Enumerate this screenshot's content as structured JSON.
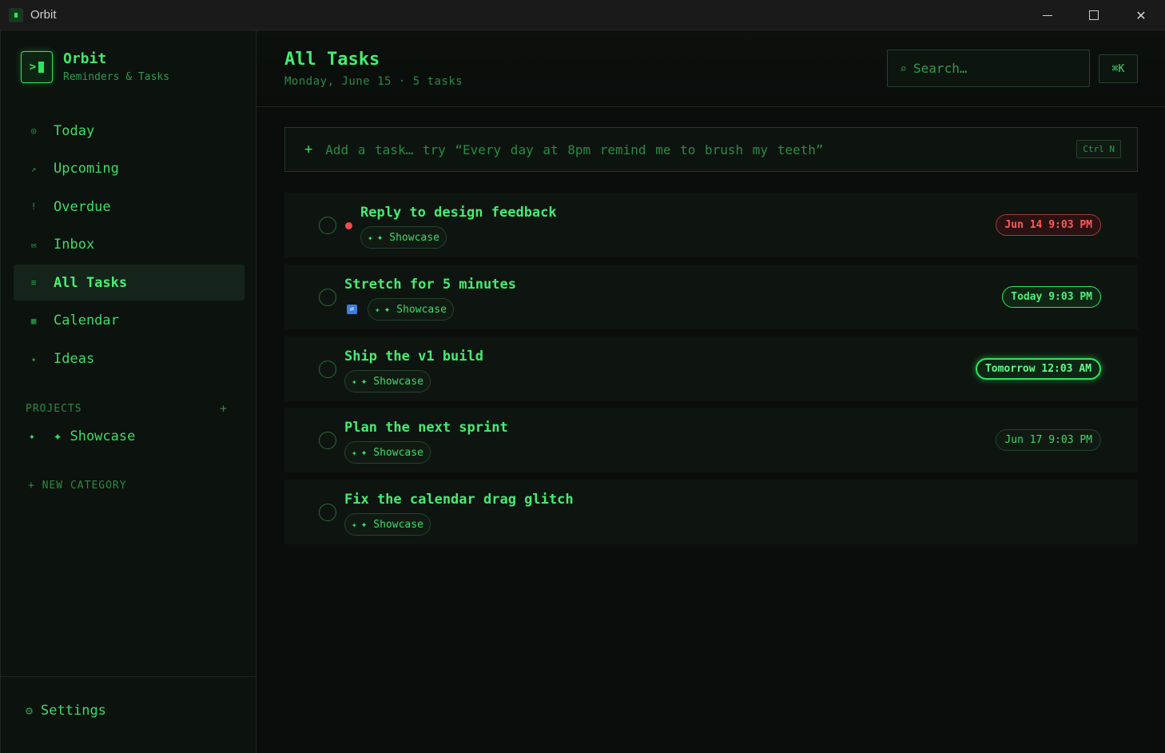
{
  "window": {
    "title": "Orbit"
  },
  "brand": {
    "name": "Orbit",
    "subtitle": "Reminders & Tasks",
    "logo_text": ">"
  },
  "nav": [
    {
      "icon": "◎",
      "label": "Today"
    },
    {
      "icon": "↗",
      "label": "Upcoming"
    },
    {
      "icon": "!",
      "label": "Overdue"
    },
    {
      "icon": "✉",
      "label": "Inbox"
    },
    {
      "icon": "≡",
      "label": "All Tasks"
    },
    {
      "icon": "▦",
      "label": "Calendar"
    },
    {
      "icon": "✦",
      "label": "Ideas"
    }
  ],
  "projects": {
    "heading": "PROJECTS",
    "add": "+",
    "items": [
      {
        "icon": "✦",
        "label": "✦ Showcase"
      }
    ]
  },
  "new_category": "+ NEW CATEGORY",
  "settings": {
    "icon": "⚙",
    "label": "Settings"
  },
  "header": {
    "title": "All Tasks",
    "subtitle": "Monday, June 15 · 5 tasks"
  },
  "search": {
    "icon": "⌕",
    "placeholder": "Search…",
    "shortcut": "⌘K"
  },
  "add_task": {
    "plus": "+",
    "placeholder": "Add a task…  try “Every day at 8pm remind me to brush my teeth”",
    "shortcut": "Ctrl N"
  },
  "tasks": [
    {
      "title": "Reply to design feedback",
      "project": "✦ Showcase",
      "project_icon": "✦",
      "due": "Jun 14 9:03 PM",
      "priority": "high"
    },
    {
      "title": "Stretch for 5 minutes",
      "project": "✦ Showcase",
      "project_icon": "✦",
      "due": "Today 9:03 PM",
      "repeat_icon": "⇄"
    },
    {
      "title": "Ship the v1 build",
      "project": "✦ Showcase",
      "project_icon": "✦",
      "due": "Tomorrow 12:03 AM"
    },
    {
      "title": "Plan the next sprint",
      "project": "✦ Showcase",
      "project_icon": "✦",
      "due": "Jun 17 9:03 PM"
    },
    {
      "title": "Fix the calendar drag glitch",
      "project": "✦ Showcase",
      "project_icon": "✦",
      "due": ""
    }
  ]
}
